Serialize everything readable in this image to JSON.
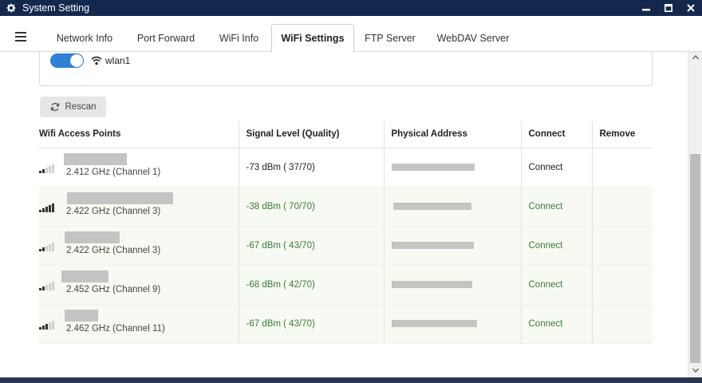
{
  "window": {
    "title": "System Setting",
    "controls": {
      "minimize": "▬",
      "maximize": "▣",
      "close": "✕"
    }
  },
  "tabs": [
    {
      "label": "Network Info"
    },
    {
      "label": "Port Forward"
    },
    {
      "label": "WiFi Info"
    },
    {
      "label": "WiFi Settings",
      "active": true
    },
    {
      "label": "FTP Server"
    },
    {
      "label": "WebDAV Server"
    }
  ],
  "interface": {
    "name": "wlan1",
    "enabled": true
  },
  "rescan": {
    "label": "Rescan"
  },
  "table": {
    "headers": {
      "ap": "Wifi Access Points",
      "signal": "Signal Level (Quality)",
      "mac": "Physical Address",
      "connect": "Connect",
      "remove": "Remove"
    },
    "rows": [
      {
        "freq": "2.412 GHz (Channel 1)",
        "signal": "-73 dBm ( 37/70)",
        "connect": "Connect",
        "bars": 2
      },
      {
        "freq": "2.422 GHz (Channel 3)",
        "signal": "-38 dBm ( 70/70)",
        "connect": "Connect",
        "bars": 5
      },
      {
        "freq": "2.422 GHz (Channel 3)",
        "signal": "-67 dBm ( 43/70)",
        "connect": "Connect",
        "bars": 3
      },
      {
        "freq": "2.452 GHz (Channel 9)",
        "signal": "-68 dBm ( 42/70)",
        "connect": "Connect",
        "bars": 3
      },
      {
        "freq": "2.462 GHz (Channel 11)",
        "signal": "-67 dBm ( 43/70)",
        "connect": "Connect",
        "bars": 3
      }
    ]
  },
  "colors": {
    "titlebar": "#14284d",
    "toggle": "#2f80d6",
    "alt_row_text": "#3c7a3a",
    "alt_row_bg": "#f7faf2"
  }
}
